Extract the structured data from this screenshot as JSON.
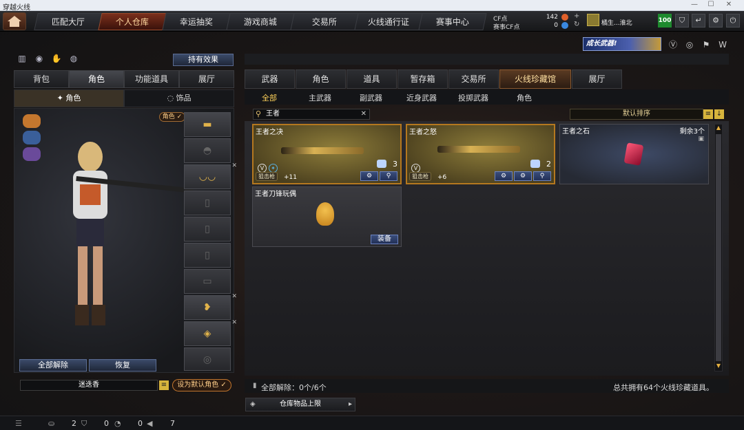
{
  "window": {
    "title": "穿越火线"
  },
  "nav": {
    "tabs": [
      "匹配大厅",
      "个人仓库",
      "幸运抽奖",
      "游戏商城",
      "交易所",
      "火线通行证",
      "赛事中心"
    ],
    "cf_label": "CF点",
    "cf_value": "142",
    "event_cf_label": "赛事CF点",
    "event_cf_value": "0",
    "username": "橘生...淮北",
    "level": "100"
  },
  "banner_text": "成长武器!",
  "left": {
    "effect_button": "持有效果",
    "tabs": [
      "背包",
      "角色",
      "功能道具",
      "展厅"
    ],
    "subtabs": [
      "角色",
      "饰品"
    ],
    "role_badge": "角色 ✓",
    "unequip_all": "全部解除",
    "restore": "恢复",
    "char_name": "迷迭香",
    "set_default": "设为默认角色 ✓"
  },
  "right": {
    "tabs": [
      "武器",
      "角色",
      "道具",
      "暂存箱",
      "交易所",
      "火线珍藏馆",
      "展厅"
    ],
    "subtabs": [
      "全部",
      "主武器",
      "副武器",
      "近身武器",
      "投掷武器",
      "角色"
    ],
    "search_value": "王者",
    "sort_label": "默认排序",
    "items": [
      {
        "name": "王者之决",
        "type": "狙击枪",
        "count": "+11",
        "charge": "3"
      },
      {
        "name": "王者之怒",
        "type": "狙击枪",
        "count": "+6",
        "charge": "2"
      },
      {
        "name": "王者之石",
        "remaining": "剩余3个"
      },
      {
        "name": "王者刀锋玩偶",
        "action": "装备"
      }
    ],
    "footer_left": "全部解除：0个/6个",
    "footer_right": "总共拥有64个火线珍藏道具。",
    "stock_limit": "仓库物品上限"
  },
  "status": {
    "count1": "2",
    "count2": "0",
    "count3": "0",
    "count4": "7"
  }
}
